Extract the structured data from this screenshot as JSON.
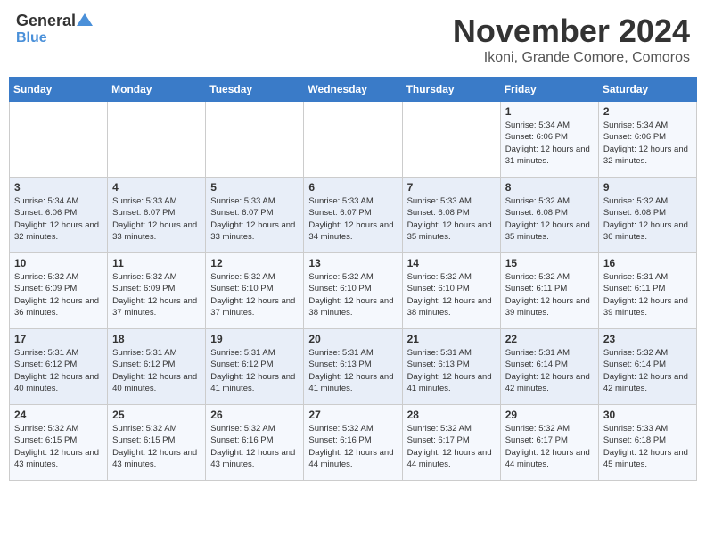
{
  "header": {
    "logo_line1": "General",
    "logo_line2": "Blue",
    "month": "November 2024",
    "location": "Ikoni, Grande Comore, Comoros"
  },
  "days_of_week": [
    "Sunday",
    "Monday",
    "Tuesday",
    "Wednesday",
    "Thursday",
    "Friday",
    "Saturday"
  ],
  "weeks": [
    [
      {
        "day": "",
        "content": ""
      },
      {
        "day": "",
        "content": ""
      },
      {
        "day": "",
        "content": ""
      },
      {
        "day": "",
        "content": ""
      },
      {
        "day": "",
        "content": ""
      },
      {
        "day": "1",
        "content": "Sunrise: 5:34 AM\nSunset: 6:06 PM\nDaylight: 12 hours and 31 minutes."
      },
      {
        "day": "2",
        "content": "Sunrise: 5:34 AM\nSunset: 6:06 PM\nDaylight: 12 hours and 32 minutes."
      }
    ],
    [
      {
        "day": "3",
        "content": "Sunrise: 5:34 AM\nSunset: 6:06 PM\nDaylight: 12 hours and 32 minutes."
      },
      {
        "day": "4",
        "content": "Sunrise: 5:33 AM\nSunset: 6:07 PM\nDaylight: 12 hours and 33 minutes."
      },
      {
        "day": "5",
        "content": "Sunrise: 5:33 AM\nSunset: 6:07 PM\nDaylight: 12 hours and 33 minutes."
      },
      {
        "day": "6",
        "content": "Sunrise: 5:33 AM\nSunset: 6:07 PM\nDaylight: 12 hours and 34 minutes."
      },
      {
        "day": "7",
        "content": "Sunrise: 5:33 AM\nSunset: 6:08 PM\nDaylight: 12 hours and 35 minutes."
      },
      {
        "day": "8",
        "content": "Sunrise: 5:32 AM\nSunset: 6:08 PM\nDaylight: 12 hours and 35 minutes."
      },
      {
        "day": "9",
        "content": "Sunrise: 5:32 AM\nSunset: 6:08 PM\nDaylight: 12 hours and 36 minutes."
      }
    ],
    [
      {
        "day": "10",
        "content": "Sunrise: 5:32 AM\nSunset: 6:09 PM\nDaylight: 12 hours and 36 minutes."
      },
      {
        "day": "11",
        "content": "Sunrise: 5:32 AM\nSunset: 6:09 PM\nDaylight: 12 hours and 37 minutes."
      },
      {
        "day": "12",
        "content": "Sunrise: 5:32 AM\nSunset: 6:10 PM\nDaylight: 12 hours and 37 minutes."
      },
      {
        "day": "13",
        "content": "Sunrise: 5:32 AM\nSunset: 6:10 PM\nDaylight: 12 hours and 38 minutes."
      },
      {
        "day": "14",
        "content": "Sunrise: 5:32 AM\nSunset: 6:10 PM\nDaylight: 12 hours and 38 minutes."
      },
      {
        "day": "15",
        "content": "Sunrise: 5:32 AM\nSunset: 6:11 PM\nDaylight: 12 hours and 39 minutes."
      },
      {
        "day": "16",
        "content": "Sunrise: 5:31 AM\nSunset: 6:11 PM\nDaylight: 12 hours and 39 minutes."
      }
    ],
    [
      {
        "day": "17",
        "content": "Sunrise: 5:31 AM\nSunset: 6:12 PM\nDaylight: 12 hours and 40 minutes."
      },
      {
        "day": "18",
        "content": "Sunrise: 5:31 AM\nSunset: 6:12 PM\nDaylight: 12 hours and 40 minutes."
      },
      {
        "day": "19",
        "content": "Sunrise: 5:31 AM\nSunset: 6:12 PM\nDaylight: 12 hours and 41 minutes."
      },
      {
        "day": "20",
        "content": "Sunrise: 5:31 AM\nSunset: 6:13 PM\nDaylight: 12 hours and 41 minutes."
      },
      {
        "day": "21",
        "content": "Sunrise: 5:31 AM\nSunset: 6:13 PM\nDaylight: 12 hours and 41 minutes."
      },
      {
        "day": "22",
        "content": "Sunrise: 5:31 AM\nSunset: 6:14 PM\nDaylight: 12 hours and 42 minutes."
      },
      {
        "day": "23",
        "content": "Sunrise: 5:32 AM\nSunset: 6:14 PM\nDaylight: 12 hours and 42 minutes."
      }
    ],
    [
      {
        "day": "24",
        "content": "Sunrise: 5:32 AM\nSunset: 6:15 PM\nDaylight: 12 hours and 43 minutes."
      },
      {
        "day": "25",
        "content": "Sunrise: 5:32 AM\nSunset: 6:15 PM\nDaylight: 12 hours and 43 minutes."
      },
      {
        "day": "26",
        "content": "Sunrise: 5:32 AM\nSunset: 6:16 PM\nDaylight: 12 hours and 43 minutes."
      },
      {
        "day": "27",
        "content": "Sunrise: 5:32 AM\nSunset: 6:16 PM\nDaylight: 12 hours and 44 minutes."
      },
      {
        "day": "28",
        "content": "Sunrise: 5:32 AM\nSunset: 6:17 PM\nDaylight: 12 hours and 44 minutes."
      },
      {
        "day": "29",
        "content": "Sunrise: 5:32 AM\nSunset: 6:17 PM\nDaylight: 12 hours and 44 minutes."
      },
      {
        "day": "30",
        "content": "Sunrise: 5:33 AM\nSunset: 6:18 PM\nDaylight: 12 hours and 45 minutes."
      }
    ]
  ]
}
